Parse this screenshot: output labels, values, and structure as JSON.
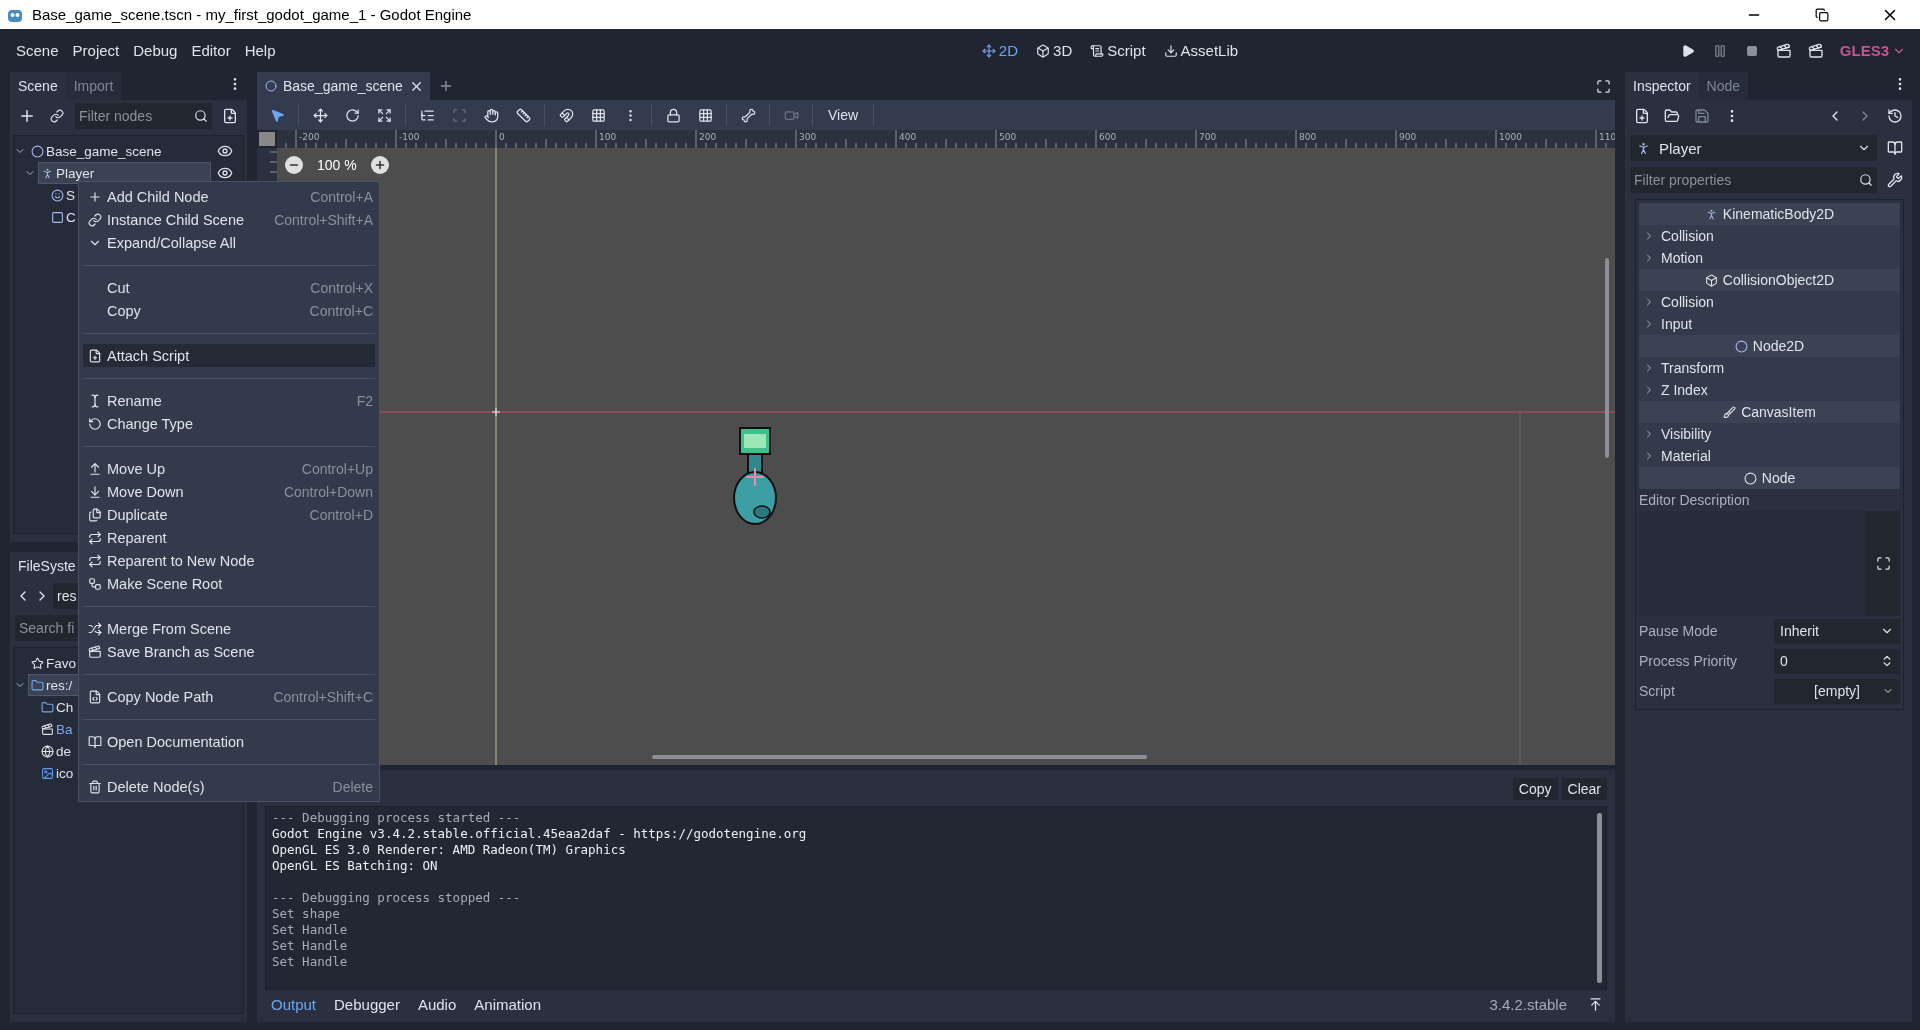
{
  "window": {
    "title": "Base_game_scene.tscn - my_first_godot_game_1 - Godot Engine"
  },
  "menu": [
    "Scene",
    "Project",
    "Debug",
    "Editor",
    "Help"
  ],
  "workspaces": [
    {
      "label": "2D",
      "kind": "plane",
      "selected": true
    },
    {
      "label": "3D",
      "kind": "space",
      "selected": false
    },
    {
      "label": "Script",
      "kind": "script",
      "selected": false
    },
    {
      "label": "AssetLib",
      "kind": "assetlib",
      "selected": false
    }
  ],
  "renderer": "GLES3",
  "scene_dock": {
    "tabs": [
      {
        "label": "Scene",
        "selected": true
      },
      {
        "label": "Import",
        "selected": false
      }
    ],
    "filter_placeholder": "Filter nodes",
    "tree": [
      {
        "name": "Base_game_scene",
        "kind": "node2d",
        "visible": true,
        "selected": false,
        "children": [
          {
            "name": "Player",
            "kind": "kinematic",
            "visible": true,
            "selected": true,
            "children": [
              {
                "name": "S",
                "kind": "sprite",
                "selected": false
              },
              {
                "name": "C",
                "kind": "shape",
                "selected": false
              }
            ]
          }
        ]
      }
    ]
  },
  "filesystem": {
    "title": "FileSyste",
    "path": "res",
    "search_placeholder": "Search fi",
    "tree": [
      {
        "name": "Favo",
        "kind": "favorites",
        "selected": false
      },
      {
        "name": "res:/",
        "kind": "folder",
        "selected": true,
        "children": [
          {
            "name": "Ch",
            "kind": "folder",
            "selected": false
          },
          {
            "name": "Ba",
            "kind": "scene",
            "selected": false
          },
          {
            "name": "de",
            "kind": "env",
            "selected": false
          },
          {
            "name": "ico",
            "kind": "image",
            "selected": false
          }
        ]
      }
    ]
  },
  "scene_tabs": [
    {
      "label": "Base_game_scene",
      "selected": true
    }
  ],
  "view_menu": "View",
  "zoom": "100 %",
  "ruler_labels": [
    "-200",
    "-100",
    "0",
    "100",
    "200",
    "300",
    "400",
    "500",
    "600",
    "700",
    "800",
    "900",
    "1000",
    "110"
  ],
  "context_menu": [
    [
      {
        "label": "Add Child Node",
        "shortcut": "Control+A",
        "kind": "add",
        "selected": false
      },
      {
        "label": "Instance Child Scene",
        "shortcut": "Control+Shift+A",
        "kind": "instance",
        "selected": false
      },
      {
        "label": "Expand/Collapse All",
        "kind": "expand",
        "selected": false
      }
    ],
    [
      {
        "label": "Cut",
        "shortcut": "Control+X",
        "kind": "cut",
        "selected": false
      },
      {
        "label": "Copy",
        "shortcut": "Control+C",
        "kind": "copy",
        "selected": false
      }
    ],
    [
      {
        "label": "Attach Script",
        "kind": "attach",
        "selected": true
      }
    ],
    [
      {
        "label": "Rename",
        "shortcut": "F2",
        "kind": "rename",
        "selected": false
      },
      {
        "label": "Change Type",
        "kind": "change",
        "selected": false
      }
    ],
    [
      {
        "label": "Move Up",
        "shortcut": "Control+Up",
        "kind": "up",
        "selected": false
      },
      {
        "label": "Move Down",
        "shortcut": "Control+Down",
        "kind": "down",
        "selected": false
      },
      {
        "label": "Duplicate",
        "shortcut": "Control+D",
        "kind": "duplicate",
        "selected": false
      },
      {
        "label": "Reparent",
        "kind": "reparent",
        "selected": false
      },
      {
        "label": "Reparent to New Node",
        "kind": "reparent",
        "selected": false
      },
      {
        "label": "Make Scene Root",
        "kind": "root",
        "selected": false
      }
    ],
    [
      {
        "label": "Merge From Scene",
        "kind": "merge",
        "selected": false
      },
      {
        "label": "Save Branch as Scene",
        "kind": "branch",
        "selected": false
      }
    ],
    [
      {
        "label": "Copy Node Path",
        "shortcut": "Control+Shift+C",
        "kind": "path",
        "selected": false
      }
    ],
    [
      {
        "label": "Open Documentation",
        "kind": "docs",
        "selected": false
      }
    ],
    [
      {
        "label": "Delete Node(s)",
        "shortcut": "Delete",
        "kind": "delete",
        "selected": false
      }
    ]
  ],
  "output": {
    "buttons": [
      "Copy",
      "Clear"
    ],
    "lines": [
      {
        "text": "--- Debugging process started ---",
        "kind": "dim"
      },
      {
        "text": "Godot Engine v3.4.2.stable.official.45eaa2daf - https://godotengine.org",
        "kind": "bright"
      },
      {
        "text": "OpenGL ES 3.0 Renderer: AMD Radeon(TM) Graphics",
        "kind": "bright"
      },
      {
        "text": "OpenGL ES Batching: ON",
        "kind": "bright"
      },
      {
        "kind": "blank"
      },
      {
        "text": "--- Debugging process stopped ---",
        "kind": "dim"
      },
      {
        "text": "Set shape",
        "kind": "dim"
      },
      {
        "text": "Set Handle",
        "kind": "dim"
      },
      {
        "text": "Set Handle",
        "kind": "dim"
      },
      {
        "text": "Set Handle",
        "kind": "dim"
      }
    ],
    "tabs": [
      {
        "label": "Output",
        "selected": true
      },
      {
        "label": "Debugger",
        "selected": false
      },
      {
        "label": "Audio",
        "selected": false
      },
      {
        "label": "Animation",
        "selected": false
      }
    ],
    "version": "3.4.2.stable"
  },
  "inspector": {
    "tabs": [
      {
        "label": "Inspector",
        "selected": true
      },
      {
        "label": "Node",
        "selected": false
      }
    ],
    "object": "Player",
    "filter_placeholder": "Filter properties",
    "sections": [
      {
        "title": "KinematicBody2D",
        "kind": "kinematic",
        "groups": [
          "Collision",
          "Motion"
        ]
      },
      {
        "title": "CollisionObject2D",
        "kind": "collision_object",
        "groups": [
          "Collision",
          "Input"
        ]
      },
      {
        "title": "Node2D",
        "kind": "node2d",
        "groups": [
          "Transform",
          "Z Index"
        ]
      },
      {
        "title": "CanvasItem",
        "kind": "canvas_item",
        "groups": [
          "Visibility",
          "Material"
        ]
      },
      {
        "title": "Node",
        "kind": "node"
      }
    ],
    "editor_description": "Editor Description",
    "properties": [
      {
        "label": "Pause Mode",
        "value": "Inherit",
        "kind": "select"
      },
      {
        "label": "Process Priority",
        "value": "0",
        "kind": "spin"
      },
      {
        "label": "Script",
        "value": "[empty]",
        "kind": "resource"
      }
    ]
  }
}
